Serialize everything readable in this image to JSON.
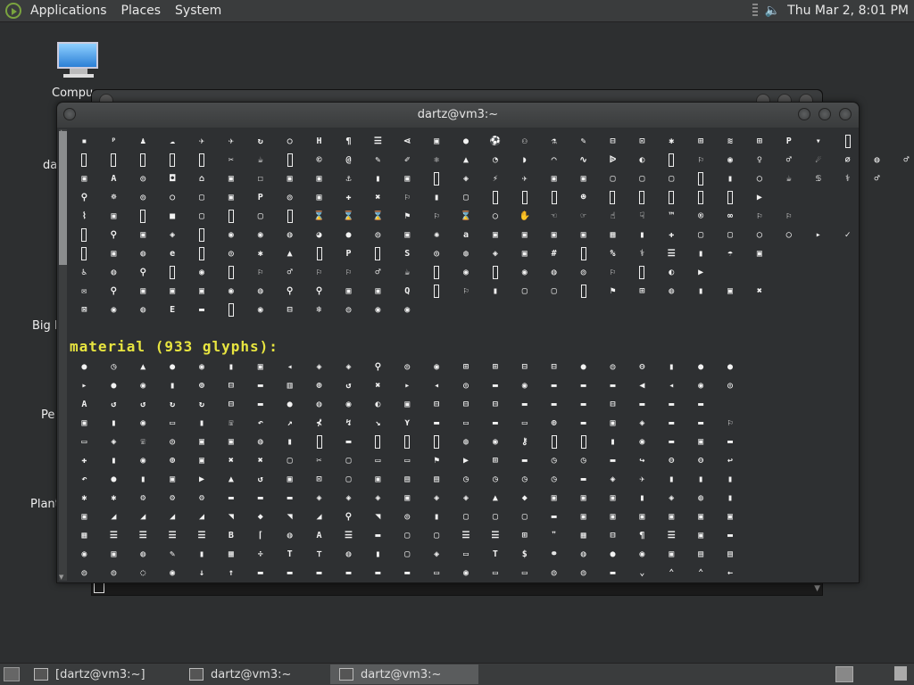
{
  "top_panel": {
    "menus": [
      "Applications",
      "Places",
      "System"
    ],
    "clock": "Thu Mar  2,  8:01 PM"
  },
  "desktop": {
    "icons": [
      {
        "label": "Compu",
        "icon": "computer-icon"
      },
      {
        "label": "da",
        "icon": "folder-icon"
      },
      {
        "label": "Big M",
        "icon": "file-icon"
      },
      {
        "label": "Pe",
        "icon": "file-icon"
      },
      {
        "label": "Plant",
        "icon": "file-icon"
      }
    ]
  },
  "front_window": {
    "title": "dartz@vm3:~",
    "section_heading": "material (933 glyphs):"
  },
  "taskbar": {
    "tasks": [
      {
        "label": "[dartz@vm3:~]",
        "active": false
      },
      {
        "label": "dartz@vm3:~",
        "active": false
      },
      {
        "label": "dartz@vm3:~",
        "active": true
      }
    ]
  },
  "glyph_rows": {
    "top": [
      "▪ᵖ♟☁✈✈↻○H¶☰⋖▣●⚽⚇⚗✎⊟⊡✱⊞≋⊞P▾▯",
      "▯▯▯▯▯✂☕▯©@✎✐⚛▲◔◗◠∿ᐉ◐▯⚐◉♀♂☄∅◍♂",
      "▣A◎◘⌂▣☐▣▣⚓▮▣▯◈⚡✈▣▣▢▢▢▯▮◯☕♋⚕♂",
      "⚲☸◎○▢▣P◎▣✚✖⚐▮▢▯▯▯☻▯▯▯▯▯▶",
      "⌇▣▯■▢▯▢▯⌛⌛⌛⚑⚐⌛◯✋☜☞☝☟™®∞⚐⚐",
      "▯⚲▣◈▯◉◉◍◕●◎▣✺a▣▣▣▣▦▮✚▢▢◯◯▸✓",
      "▯▣◍e▯◎✱▲▯P▯S◎◍◈▣#▯%⚕☰▮☂▣",
      "♿◍⚲▯◉▯⚐♂⚐⚐♂☕▯◉▯◉◍◎⚐▯◐▶",
      "✉⚲▣▣▣◉◍⚲⚲▣▣Q▯⚐▮▢▢▯⚑⊞◍▮▣✖",
      "⊠◉◍E▬▯◉⊟❄◎◉◉"
    ],
    "material": [
      "●◷▲●◉▮▣◂◈◈⚲◎◉⊞⊞⊟⊟●◎⊖▮●●",
      "▸●◉▮⊕⊟▬▥⊕↺✖▸◂◎▬◉▬▬▬◀◂◉◎",
      "A↺↺↻↻⊟▬●◍◉◐▣⊟⊟⊟▬▬▬⊟▬▬▬",
      "▣▮◉▭▮☏↶↗⊀↯↘⋎▬▭▬▭⊕▬▣◈▬▬⚐",
      "▭◈☏◎▣▣◍▮▯▬▯▯▯◍◉⚷▯▯▮◉▬▣▬",
      "✚▮◉⊕▣✖✖▢✂▢▭▭⚑▶⊞▬◷◷▬↪⊖⊖↩",
      "↶●▮▣▶▲↺▣⊡▢▣▤▤◷◷◷◷▬◈✈▮▮▮",
      "✱✱⚙⚙⚙▬▬▬◈◈◈▣◈◈▲◆▣▣▣▮◈◍▮",
      "▣◢◢◢◢◥◆◥◢⚲◥◎▮▢▢▢▬▣▣▣▣▣▣",
      "▦☰☰☰☰B⌈◍A☰▬▢▢☰☰⊞❞▦⊟¶☰▣▬",
      "◉▣◍✎▮▦÷T⊤◍▮▢◈▭T$⚭◍●◉▣▤▤",
      "◎◎◌◉↓↑▬▬▬▬▬▬▭◉▭▭◎◎▬⌄⌃⌃←"
    ]
  }
}
